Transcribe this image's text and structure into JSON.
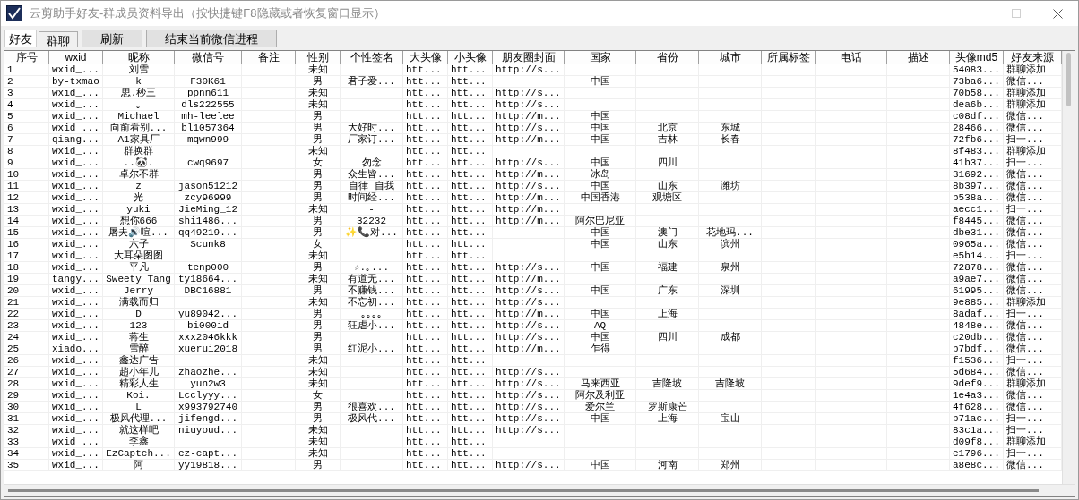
{
  "window": {
    "title": "云剪助手好友-群成员资料导出（按快捷键F8隐藏或者恢复窗口显示）",
    "maximize_disabled": true
  },
  "tabs": [
    {
      "label": "好友",
      "selected": true
    },
    {
      "label": "群聊",
      "selected": false
    }
  ],
  "buttons": [
    "刷新",
    "结束当前微信进程"
  ],
  "table": {
    "columns": [
      "序号",
      "wxid",
      "昵称",
      "微信号",
      "备注",
      "性别",
      "个性签名",
      "大头像",
      "小头像",
      "朋友圈封面",
      "国家",
      "省份",
      "城市",
      "所属标签",
      "电话",
      "描述",
      "头像md5",
      "好友来源"
    ],
    "rows": [
      {
        "no": "1",
        "wxid": "wxid_...",
        "nickname": "刘雪",
        "gender": "未知",
        "avatar_large": "htt...",
        "avatar_small": "htt...",
        "moments_cover": "http://s...",
        "avatar_md5": "54083...",
        "source": "群聊添加"
      },
      {
        "no": "2",
        "wxid": "by-txmao",
        "nickname": "k",
        "wechat_id": "F30K61",
        "gender": "男",
        "signature": "君子爱...",
        "avatar_large": "htt...",
        "avatar_small": "htt...",
        "country": "中国",
        "avatar_md5": "73ba6...",
        "source": "微信..."
      },
      {
        "no": "3",
        "wxid": "wxid_...",
        "nickname": "思.秒三",
        "wechat_id": "ppnn611",
        "gender": "未知",
        "avatar_large": "htt...",
        "avatar_small": "htt...",
        "moments_cover": "http://s...",
        "avatar_md5": "70b58...",
        "source": "群聊添加"
      },
      {
        "no": "4",
        "wxid": "wxid_...",
        "nickname": "｡",
        "wechat_id": "dls222555",
        "gender": "未知",
        "avatar_large": "htt...",
        "avatar_small": "htt...",
        "moments_cover": "http://s...",
        "avatar_md5": "dea6b...",
        "source": "群聊添加"
      },
      {
        "no": "5",
        "wxid": "wxid_...",
        "nickname": "Michael",
        "wechat_id": "mh-leelee",
        "gender": "男",
        "avatar_large": "htt...",
        "avatar_small": "htt...",
        "moments_cover": "http://m...",
        "country": "中国",
        "avatar_md5": "c08df...",
        "source": "微信..."
      },
      {
        "no": "6",
        "wxid": "wxid_...",
        "nickname": "向前看别...",
        "wechat_id": "bl1057364",
        "gender": "男",
        "signature": "大好时...",
        "avatar_large": "htt...",
        "avatar_small": "htt...",
        "moments_cover": "http://s...",
        "country": "中国",
        "province": "北京",
        "city": "东城",
        "avatar_md5": "28466...",
        "source": "微信..."
      },
      {
        "no": "7",
        "wxid": "qiang...",
        "nickname": "A1家具厂",
        "wechat_id": "mqwn999",
        "gender": "男",
        "signature": "厂家订...",
        "avatar_large": "htt...",
        "avatar_small": "htt...",
        "moments_cover": "http://m...",
        "country": "中国",
        "province": "吉林",
        "city": "长春",
        "avatar_md5": "72fb6...",
        "source": "扫一..."
      },
      {
        "no": "8",
        "wxid": "wxid_...",
        "nickname": "群换群",
        "gender": "未知",
        "avatar_large": "htt...",
        "avatar_small": "htt...",
        "avatar_md5": "8f483...",
        "source": "群聊添加"
      },
      {
        "no": "9",
        "wxid": "wxid_...",
        "nickname": "..🐼.",
        "wechat_id": "cwq9697",
        "gender": "女",
        "signature": "勿念",
        "avatar_large": "htt...",
        "avatar_small": "htt...",
        "moments_cover": "http://s...",
        "country": "中国",
        "province": "四川",
        "avatar_md5": "41b37...",
        "source": "扫一..."
      },
      {
        "no": "10",
        "wxid": "wxid_...",
        "nickname": "卓尔不群",
        "gender": "男",
        "signature": "众生皆...",
        "avatar_large": "htt...",
        "avatar_small": "htt...",
        "moments_cover": "http://m...",
        "country": "冰岛",
        "avatar_md5": "31692...",
        "source": "微信..."
      },
      {
        "no": "11",
        "wxid": "wxid_...",
        "nickname": "z",
        "wechat_id": "jason51212",
        "gender": "男",
        "signature": "自律 自我",
        "avatar_large": "htt...",
        "avatar_small": "htt...",
        "moments_cover": "http://s...",
        "country": "中国",
        "province": "山东",
        "city": "潍坊",
        "avatar_md5": "8b397...",
        "source": "微信..."
      },
      {
        "no": "12",
        "wxid": "wxid_...",
        "nickname": "光",
        "wechat_id": "zcy96999",
        "gender": "男",
        "signature": "时间经...",
        "avatar_large": "htt...",
        "avatar_small": "htt...",
        "moments_cover": "http://m...",
        "country": "中国香港",
        "province": "观塘区",
        "avatar_md5": "b538a...",
        "source": "微信..."
      },
      {
        "no": "13",
        "wxid": "wxid_...",
        "nickname": "yuki",
        "wechat_id": "JieMing_12",
        "gender": "未知",
        "signature": "-",
        "avatar_large": "htt...",
        "avatar_small": "htt...",
        "moments_cover": "http://m...",
        "avatar_md5": "aecc1...",
        "source": "扫一..."
      },
      {
        "no": "14",
        "wxid": "wxid_...",
        "nickname": "想你666",
        "wechat_id": "shi1486...",
        "gender": "男",
        "signature": "32232",
        "avatar_large": "htt...",
        "avatar_small": "htt...",
        "moments_cover": "http://m...",
        "country": "阿尔巴尼亚",
        "avatar_md5": "f8445...",
        "source": "微信..."
      },
      {
        "no": "15",
        "wxid": "wxid_...",
        "nickname": "屠夫🔊喧...",
        "wechat_id": "qq49219...",
        "gender": "男",
        "signature": "✨📞对...",
        "avatar_large": "htt...",
        "avatar_small": "htt...",
        "country": "中国",
        "province": "澳门",
        "city": "花地玛...",
        "avatar_md5": "dbe31...",
        "source": "微信..."
      },
      {
        "no": "16",
        "wxid": "wxid_...",
        "nickname": "六子",
        "wechat_id": "Scunk8",
        "gender": "女",
        "avatar_large": "htt...",
        "avatar_small": "htt...",
        "country": "中国",
        "province": "山东",
        "city": "滨州",
        "avatar_md5": "0965a...",
        "source": "微信..."
      },
      {
        "no": "17",
        "wxid": "wxid_...",
        "nickname": "大耳朵图图",
        "gender": "未知",
        "avatar_large": "htt...",
        "avatar_small": "htt...",
        "avatar_md5": "e5b14...",
        "source": "扫一..."
      },
      {
        "no": "18",
        "wxid": "wxid_...",
        "nickname": "平凡",
        "wechat_id": "tenp000",
        "gender": "男",
        "signature": "☆.｡...",
        "avatar_large": "htt...",
        "avatar_small": "htt...",
        "moments_cover": "http://s...",
        "country": "中国",
        "province": "福建",
        "city": "泉州",
        "avatar_md5": "72878...",
        "source": "微信..."
      },
      {
        "no": "19",
        "wxid": "tangy...",
        "nickname": "Sweety Tang",
        "wechat_id": "ty18664...",
        "gender": "未知",
        "signature": "有道无...",
        "avatar_large": "htt...",
        "avatar_small": "htt...",
        "moments_cover": "http://m...",
        "avatar_md5": "a9ae7...",
        "source": "微信..."
      },
      {
        "no": "20",
        "wxid": "wxid_...",
        "nickname": "Jerry",
        "wechat_id": "DBC16881",
        "gender": "男",
        "signature": "不赚钱...",
        "avatar_large": "htt...",
        "avatar_small": "htt...",
        "moments_cover": "http://s...",
        "country": "中国",
        "province": "广东",
        "city": "深圳",
        "avatar_md5": "61995...",
        "source": "微信..."
      },
      {
        "no": "21",
        "wxid": "wxid_...",
        "nickname": "满载而归",
        "gender": "未知",
        "signature": "不忘初...",
        "avatar_large": "htt...",
        "avatar_small": "htt...",
        "moments_cover": "http://s...",
        "avatar_md5": "9e885...",
        "source": "群聊添加"
      },
      {
        "no": "22",
        "wxid": "wxid_...",
        "nickname": "D",
        "wechat_id": "yu89042...",
        "gender": "男",
        "signature": "｡｡｡｡",
        "avatar_large": "htt...",
        "avatar_small": "htt...",
        "moments_cover": "http://m...",
        "country": "中国",
        "province": "上海",
        "avatar_md5": "8adaf...",
        "source": "扫一..."
      },
      {
        "no": "23",
        "wxid": "wxid_...",
        "nickname": "123",
        "wechat_id": "bi000id",
        "gender": "男",
        "signature": "狂虐小...",
        "avatar_large": "htt...",
        "avatar_small": "htt...",
        "moments_cover": "http://s...",
        "country": "AQ",
        "avatar_md5": "4848e...",
        "source": "微信..."
      },
      {
        "no": "24",
        "wxid": "wxid_...",
        "nickname": "蒋生",
        "wechat_id": "xxx2046kkk",
        "gender": "男",
        "avatar_large": "htt...",
        "avatar_small": "htt...",
        "moments_cover": "http://s...",
        "country": "中国",
        "province": "四川",
        "city": "成都",
        "avatar_md5": "c20db...",
        "source": "微信..."
      },
      {
        "no": "25",
        "wxid": "xiado...",
        "nickname": "雪醉",
        "wechat_id": "xuerui2018",
        "gender": "男",
        "signature": "红泥小...",
        "avatar_large": "htt...",
        "avatar_small": "htt...",
        "moments_cover": "http://m...",
        "country": "乍得",
        "avatar_md5": "b7bdf...",
        "source": "微信..."
      },
      {
        "no": "26",
        "wxid": "wxid_...",
        "nickname": "鑫达广告",
        "gender": "未知",
        "avatar_large": "htt...",
        "avatar_small": "htt...",
        "avatar_md5": "f1536...",
        "source": "扫一..."
      },
      {
        "no": "27",
        "wxid": "wxid_...",
        "nickname": "趙小年儿",
        "wechat_id": "zhaozhe...",
        "gender": "未知",
        "avatar_large": "htt...",
        "avatar_small": "htt...",
        "moments_cover": "http://s...",
        "avatar_md5": "5d684...",
        "source": "微信..."
      },
      {
        "no": "28",
        "wxid": "wxid_...",
        "nickname": "精彩人生",
        "wechat_id": "yun2w3",
        "gender": "未知",
        "avatar_large": "htt...",
        "avatar_small": "htt...",
        "moments_cover": "http://s...",
        "country": "马来西亚",
        "province": "吉隆坡",
        "city": "吉隆坡",
        "avatar_md5": "9def9...",
        "source": "群聊添加"
      },
      {
        "no": "29",
        "wxid": "wxid_...",
        "nickname": "Koi.",
        "wechat_id": "Lcclyyy...",
        "gender": "女",
        "avatar_large": "htt...",
        "avatar_small": "htt...",
        "moments_cover": "http://s...",
        "country": "阿尔及利亚",
        "avatar_md5": "1e4a3...",
        "source": "微信..."
      },
      {
        "no": "30",
        "wxid": "wxid_...",
        "nickname": "L",
        "wechat_id": "x993792740",
        "gender": "男",
        "signature": "很喜欢...",
        "avatar_large": "htt...",
        "avatar_small": "htt...",
        "moments_cover": "http://s...",
        "country": "爱尔兰",
        "province": "罗斯康芒",
        "avatar_md5": "4f628...",
        "source": "微信..."
      },
      {
        "no": "31",
        "wxid": "wxid_...",
        "nickname": "极风代理...",
        "wechat_id": "jifengd...",
        "gender": "男",
        "signature": "极风代...",
        "avatar_large": "htt...",
        "avatar_small": "htt...",
        "moments_cover": "http://s...",
        "country": "中国",
        "province": "上海",
        "city": "宝山",
        "avatar_md5": "b71ac...",
        "source": "扫一..."
      },
      {
        "no": "32",
        "wxid": "wxid_...",
        "nickname": "就这样吧",
        "wechat_id": "niuyoud...",
        "gender": "未知",
        "avatar_large": "htt...",
        "avatar_small": "htt...",
        "moments_cover": "http://s...",
        "avatar_md5": "83c1a...",
        "source": "扫一..."
      },
      {
        "no": "33",
        "wxid": "wxid_...",
        "nickname": "李鑫",
        "gender": "未知",
        "avatar_large": "htt...",
        "avatar_small": "htt...",
        "avatar_md5": "d09f8...",
        "source": "群聊添加"
      },
      {
        "no": "34",
        "wxid": "wxid_...",
        "nickname": "EzCaptch...",
        "wechat_id": "ez-capt...",
        "gender": "未知",
        "avatar_large": "htt...",
        "avatar_small": "htt...",
        "avatar_md5": "e1796...",
        "source": "扫一..."
      },
      {
        "no": "35",
        "wxid": "wxid_...",
        "nickname": "阿",
        "wechat_id": "yy19818...",
        "gender": "男",
        "avatar_large": "htt...",
        "avatar_small": "htt...",
        "moments_cover": "http://s...",
        "country": "中国",
        "province": "河南",
        "city": "郑州",
        "avatar_md5": "a8e8c...",
        "source": "微信..."
      }
    ]
  }
}
